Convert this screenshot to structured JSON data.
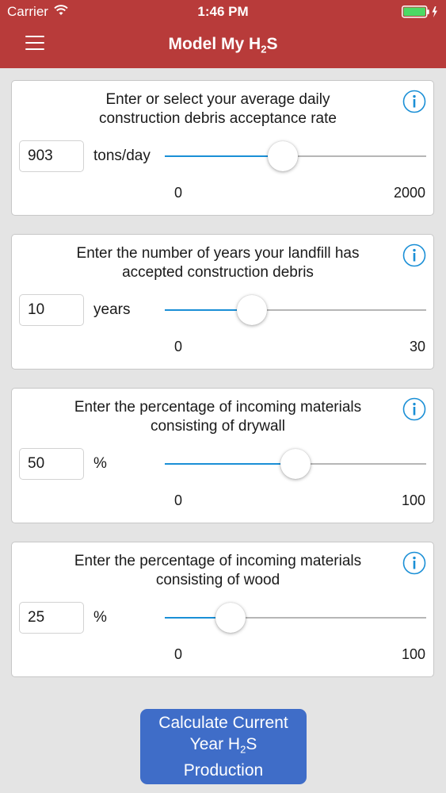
{
  "status_bar": {
    "carrier": "Carrier",
    "time": "1:46 PM",
    "battery_color": "#4cd964"
  },
  "nav": {
    "title_prefix": "Model My H",
    "title_subscript": "2",
    "title_suffix": "S",
    "background_color": "#b83b3a",
    "menu_icon": "hamburger-menu-icon"
  },
  "cards": [
    {
      "prompt_line1": "Enter or select your average daily",
      "prompt_line2": "construction debris acceptance rate",
      "value": "903",
      "unit": "tons/day",
      "min": "0",
      "max": "2000",
      "slider_fraction": 0.4515
    },
    {
      "prompt_line1": "Enter the number of years your landfill has",
      "prompt_line2": "accepted construction debris",
      "value": "10",
      "unit": "years",
      "min": "0",
      "max": "30",
      "slider_fraction": 0.3333
    },
    {
      "prompt_line1": "Enter the percentage of incoming materials",
      "prompt_line2": "consisting of drywall",
      "value": "50",
      "unit": "%",
      "min": "0",
      "max": "100",
      "slider_fraction": 0.5
    },
    {
      "prompt_line1": "Enter the percentage of incoming materials",
      "prompt_line2": "consisting of wood",
      "value": "25",
      "unit": "%",
      "min": "0",
      "max": "100",
      "slider_fraction": 0.25
    }
  ],
  "calculate_button": {
    "line1": "Calculate Current",
    "line2_prefix": "Year H",
    "line2_subscript": "2",
    "line2_suffix": "S",
    "line3": "Production",
    "color": "#3f6dc8"
  },
  "colors": {
    "accent": "#1a8fd6",
    "background": "#e4e4e4"
  }
}
